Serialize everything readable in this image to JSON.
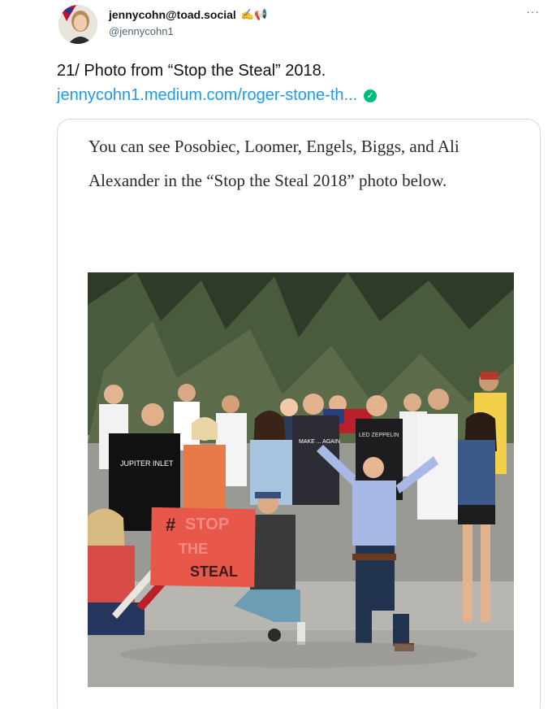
{
  "author": {
    "display_name": "jennycohn@toad.social",
    "badges": "✍️📢",
    "handle": "@jennycohn1"
  },
  "more_label": "···",
  "tweet": {
    "text": "21/ Photo from “Stop the Steal” 2018.",
    "link": "jennycohn1.medium.com/roger-stone-th...",
    "verified_mark": "✓"
  },
  "card": {
    "excerpt": "You can see Posobiec, Loomer, Engels, Biggs, and Ali Alexander in the “Stop the Steal 2018” photo below."
  },
  "photo": {
    "sign_text": [
      "#",
      "STOP",
      "THE",
      "STEAL"
    ],
    "shirt_texts": {
      "jupiter": "JUPITER INLET",
      "make": "MAKE ... AGAIN",
      "zeppelin": "LED ZEPPELIN"
    },
    "colors": {
      "sky_palm": "#3f4a36",
      "ground": "#b7b6b0",
      "sign": "#e8584a",
      "orange_top": "#e87a4a"
    }
  },
  "colors": {
    "link": "#1d9bf0",
    "verified": "#00ba7c",
    "border": "#cfd9de"
  }
}
